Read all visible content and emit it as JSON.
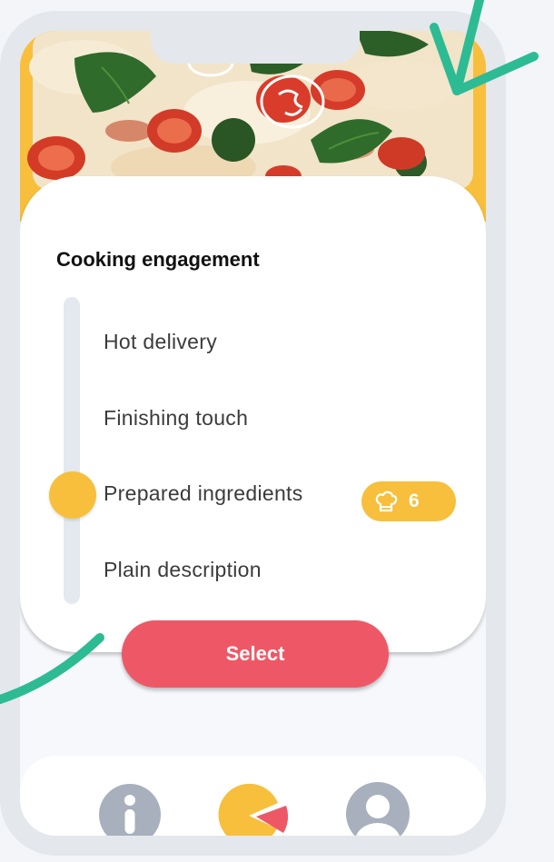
{
  "card": {
    "title": "Cooking engagement",
    "options": [
      {
        "label": "Hot delivery"
      },
      {
        "label": "Finishing touch"
      },
      {
        "label": "Prepared ingredients"
      },
      {
        "label": "Plain description"
      }
    ],
    "selected_index": 2,
    "badge": {
      "icon": "chef-hat-icon",
      "value": "6"
    }
  },
  "select_button": {
    "label": "Select"
  },
  "nav": {
    "items": [
      {
        "icon": "info-icon"
      },
      {
        "icon": "pie-chart-icon",
        "active": true
      },
      {
        "icon": "profile-icon"
      }
    ]
  },
  "colors": {
    "accent_yellow": "#f7bf3c",
    "button_red": "#ee5866",
    "decor_green": "#2dbb94",
    "icon_gray": "#a8b0bd"
  }
}
